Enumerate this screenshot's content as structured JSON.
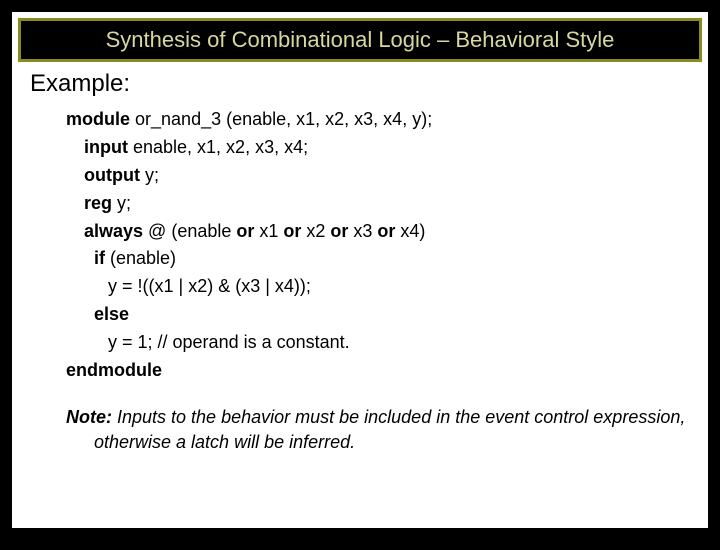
{
  "title": "Synthesis of Combinational Logic – Behavioral Style",
  "example_label": "Example:",
  "code": {
    "l1_kw": "module",
    "l1_rest": " or_nand_3 (enable, x1, x2, x3, x4, y);",
    "l2_kw": "input",
    "l2_rest": " enable, x1, x2, x3, x4;",
    "l3_kw": "output",
    "l3_rest": " y;",
    "l4_kw": "reg",
    "l4_rest": " y;",
    "l5_kw1": "always",
    "l5_mid1": " @ (enable ",
    "l5_kw2": "or",
    "l5_mid2": " x1 ",
    "l5_kw3": "or",
    "l5_mid3": " x2 ",
    "l5_kw4": "or",
    "l5_mid4": " x3 ",
    "l5_kw5": "or",
    "l5_mid5": " x4)",
    "l6_kw": "if",
    "l6_rest": " (enable)",
    "l7": "y = !((x1 | x2) & (x3 | x4));",
    "l8_kw": "else",
    "l9": "y = 1; // operand is a constant.",
    "l10_kw": "endmodule"
  },
  "note_label": "Note:",
  "note_body": " Inputs to the behavior must be included in the event control expression, otherwise a latch will be inferred."
}
